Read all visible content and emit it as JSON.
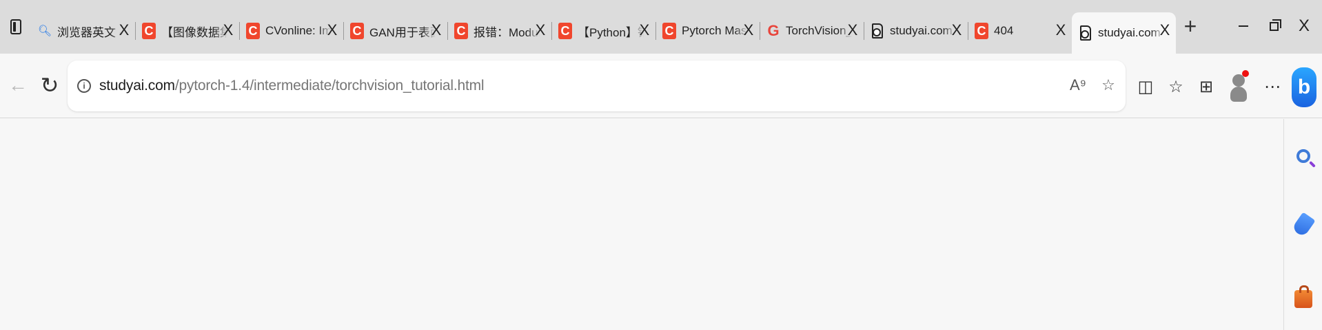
{
  "tabs": [
    {
      "favicon": "search-favicon",
      "title": "浏览器英文 - 搜索",
      "close": "X"
    },
    {
      "favicon": "csdn-favicon",
      "title": "【图像数据集】清",
      "close": "X"
    },
    {
      "favicon": "csdn-favicon",
      "title": "CVonline: Image",
      "close": "X"
    },
    {
      "favicon": "csdn-favicon",
      "title": "GAN用于表面缺陷",
      "close": "X"
    },
    {
      "favicon": "csdn-favicon",
      "title": "报错：ModuleNo",
      "close": "X"
    },
    {
      "favicon": "csdn-favicon",
      "title": "【Python】错误",
      "close": "X"
    },
    {
      "favicon": "csdn-favicon",
      "title": "Pytorch Mask RC",
      "close": "X"
    },
    {
      "favicon": "google-favicon",
      "title": "TorchVision_Mas",
      "close": "X"
    },
    {
      "favicon": "document-favicon",
      "title": "studyai.com",
      "close": "X"
    },
    {
      "favicon": "csdn-favicon",
      "title": "404",
      "close": "X"
    },
    {
      "favicon": "document-favicon",
      "title": "studyai.com",
      "close": "X",
      "active": true
    }
  ],
  "new_tab_label": "+",
  "window": {
    "close_label": "X"
  },
  "address_bar": {
    "host": "studyai.com",
    "path": "/pytorch-1.4/intermediate/torchvision_tutorial.html"
  },
  "favicon_letters": {
    "csdn": "C",
    "google": "G",
    "bing": "b"
  },
  "colors": {
    "csdn": "#f0462d",
    "google": "#e8453c",
    "accent": "#1a73e8",
    "notification": "#e11111"
  }
}
